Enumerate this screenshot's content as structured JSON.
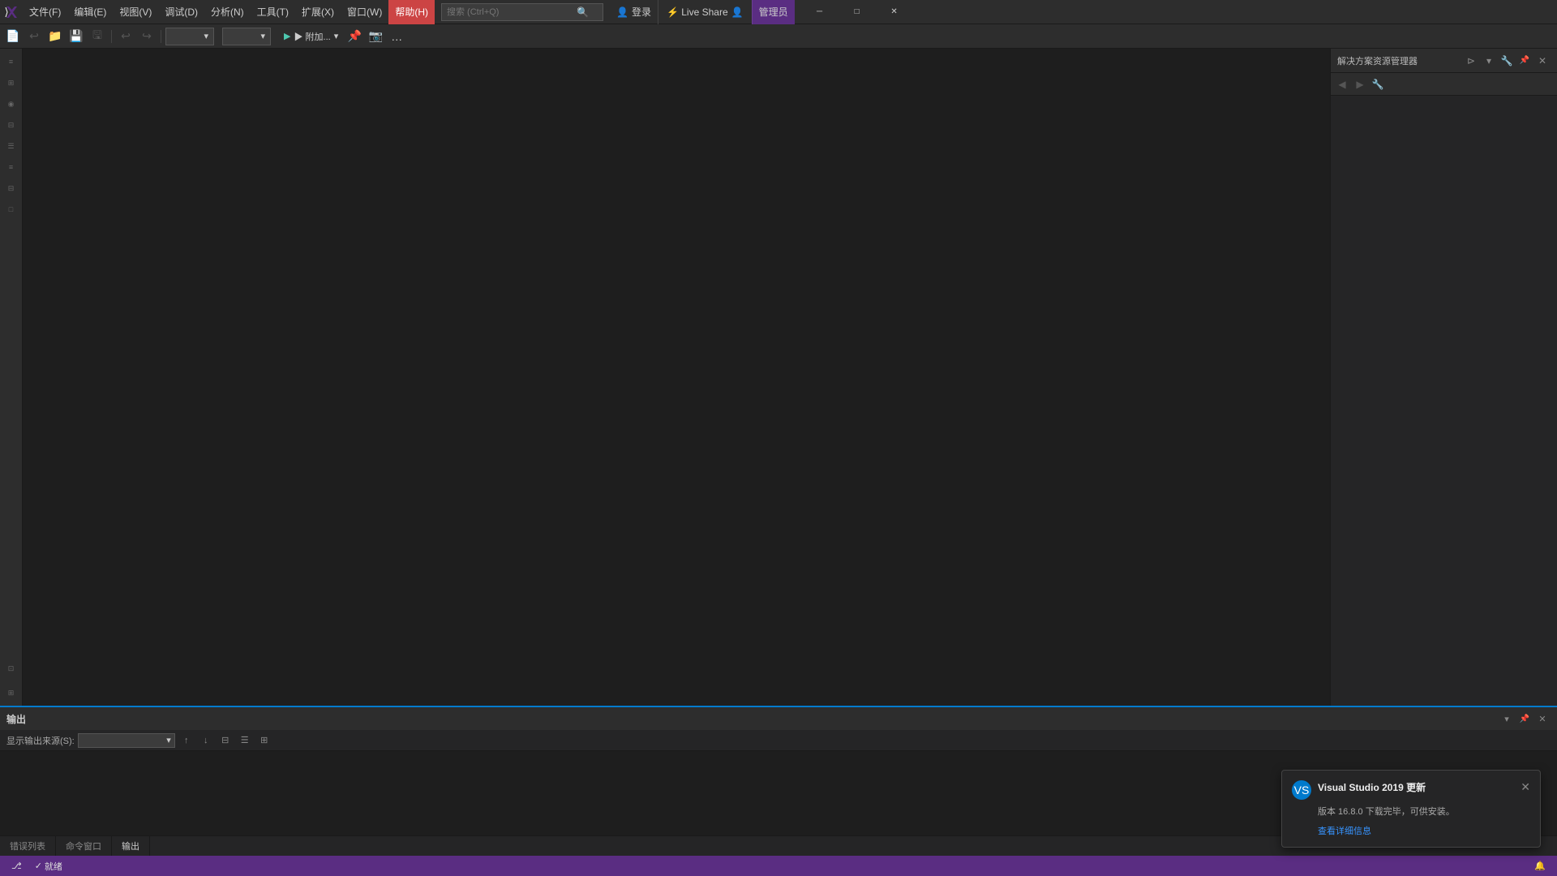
{
  "app": {
    "title": "Visual Studio 2019"
  },
  "menubar": {
    "items": [
      {
        "id": "file",
        "label": "文件(F)"
      },
      {
        "id": "edit",
        "label": "编辑(E)"
      },
      {
        "id": "view",
        "label": "视图(V)"
      },
      {
        "id": "debug",
        "label": "调试(D)"
      },
      {
        "id": "analyze",
        "label": "分析(N)"
      },
      {
        "id": "tools",
        "label": "工具(T)"
      },
      {
        "id": "extensions",
        "label": "扩展(X)"
      },
      {
        "id": "window",
        "label": "窗口(W)"
      },
      {
        "id": "help",
        "label": "帮助(H)",
        "active": true
      }
    ],
    "search_placeholder": "搜索 (Ctrl+Q)"
  },
  "header_right": {
    "login_label": "登录",
    "live_share_label": "⚡ Live Share",
    "feedback_label": "管理员"
  },
  "toolbar": {
    "run_label": "▶ 附加...",
    "config_placeholder": "",
    "platform_placeholder": ""
  },
  "right_panel": {
    "title": "解决方案资源管理器"
  },
  "output_panel": {
    "title": "输出",
    "source_label": "显示输出来源(S):",
    "source_value": ""
  },
  "bottom_tabs": [
    {
      "id": "errors",
      "label": "错误列表"
    },
    {
      "id": "cmd",
      "label": "命令窗口"
    },
    {
      "id": "output",
      "label": "输出",
      "active": true
    }
  ],
  "status_bar": {
    "ready_label": "就绪",
    "notification": {
      "title": "Visual Studio 2019 更新",
      "body": "版本 16.8.0 下载完毕，可供安装。",
      "action_label": "查看详细信息"
    }
  }
}
